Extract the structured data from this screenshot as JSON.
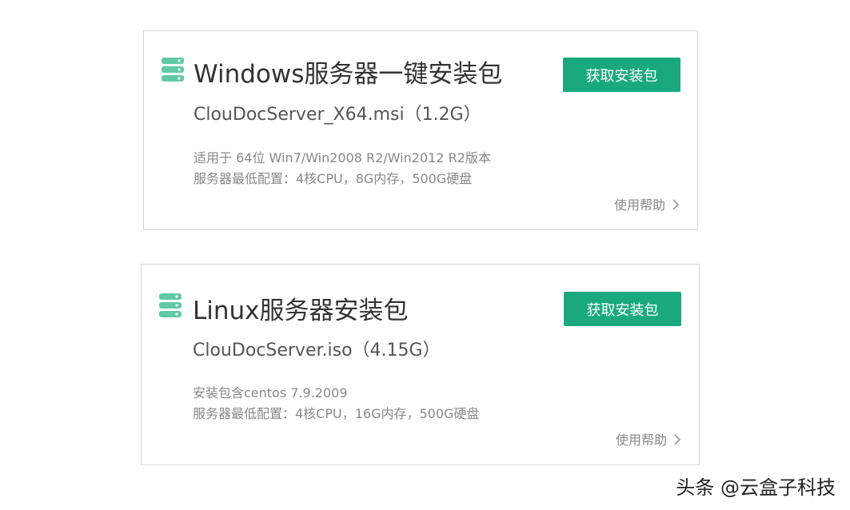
{
  "cards": [
    {
      "icon": "server-icon",
      "title": "Windows服务器一键安装包",
      "file": "ClouDocServer_X64.msi（1.2G）",
      "desc_1": "适用于 64位 Win7/Win2008 R2/Win2012 R2版本",
      "desc_2": "服务器最低配置：4核CPU，8G内存，500G硬盘",
      "button_label": "获取安装包",
      "help_label": "使用帮助"
    },
    {
      "icon": "server-icon",
      "title": "Linux服务器安装包",
      "file": "ClouDocServer.iso（4.15G）",
      "desc_1": "安装包含centos 7.9.2009",
      "desc_2": "服务器最低配置：4核CPU，16G内存，500G硬盘",
      "button_label": "获取安装包",
      "help_label": "使用帮助"
    }
  ],
  "watermark": "头条 @云盒子科技",
  "colors": {
    "accent": "#1aa97f",
    "icon": "#5fcaa5",
    "border": "#d9d9d9",
    "muted_text": "#888888"
  }
}
